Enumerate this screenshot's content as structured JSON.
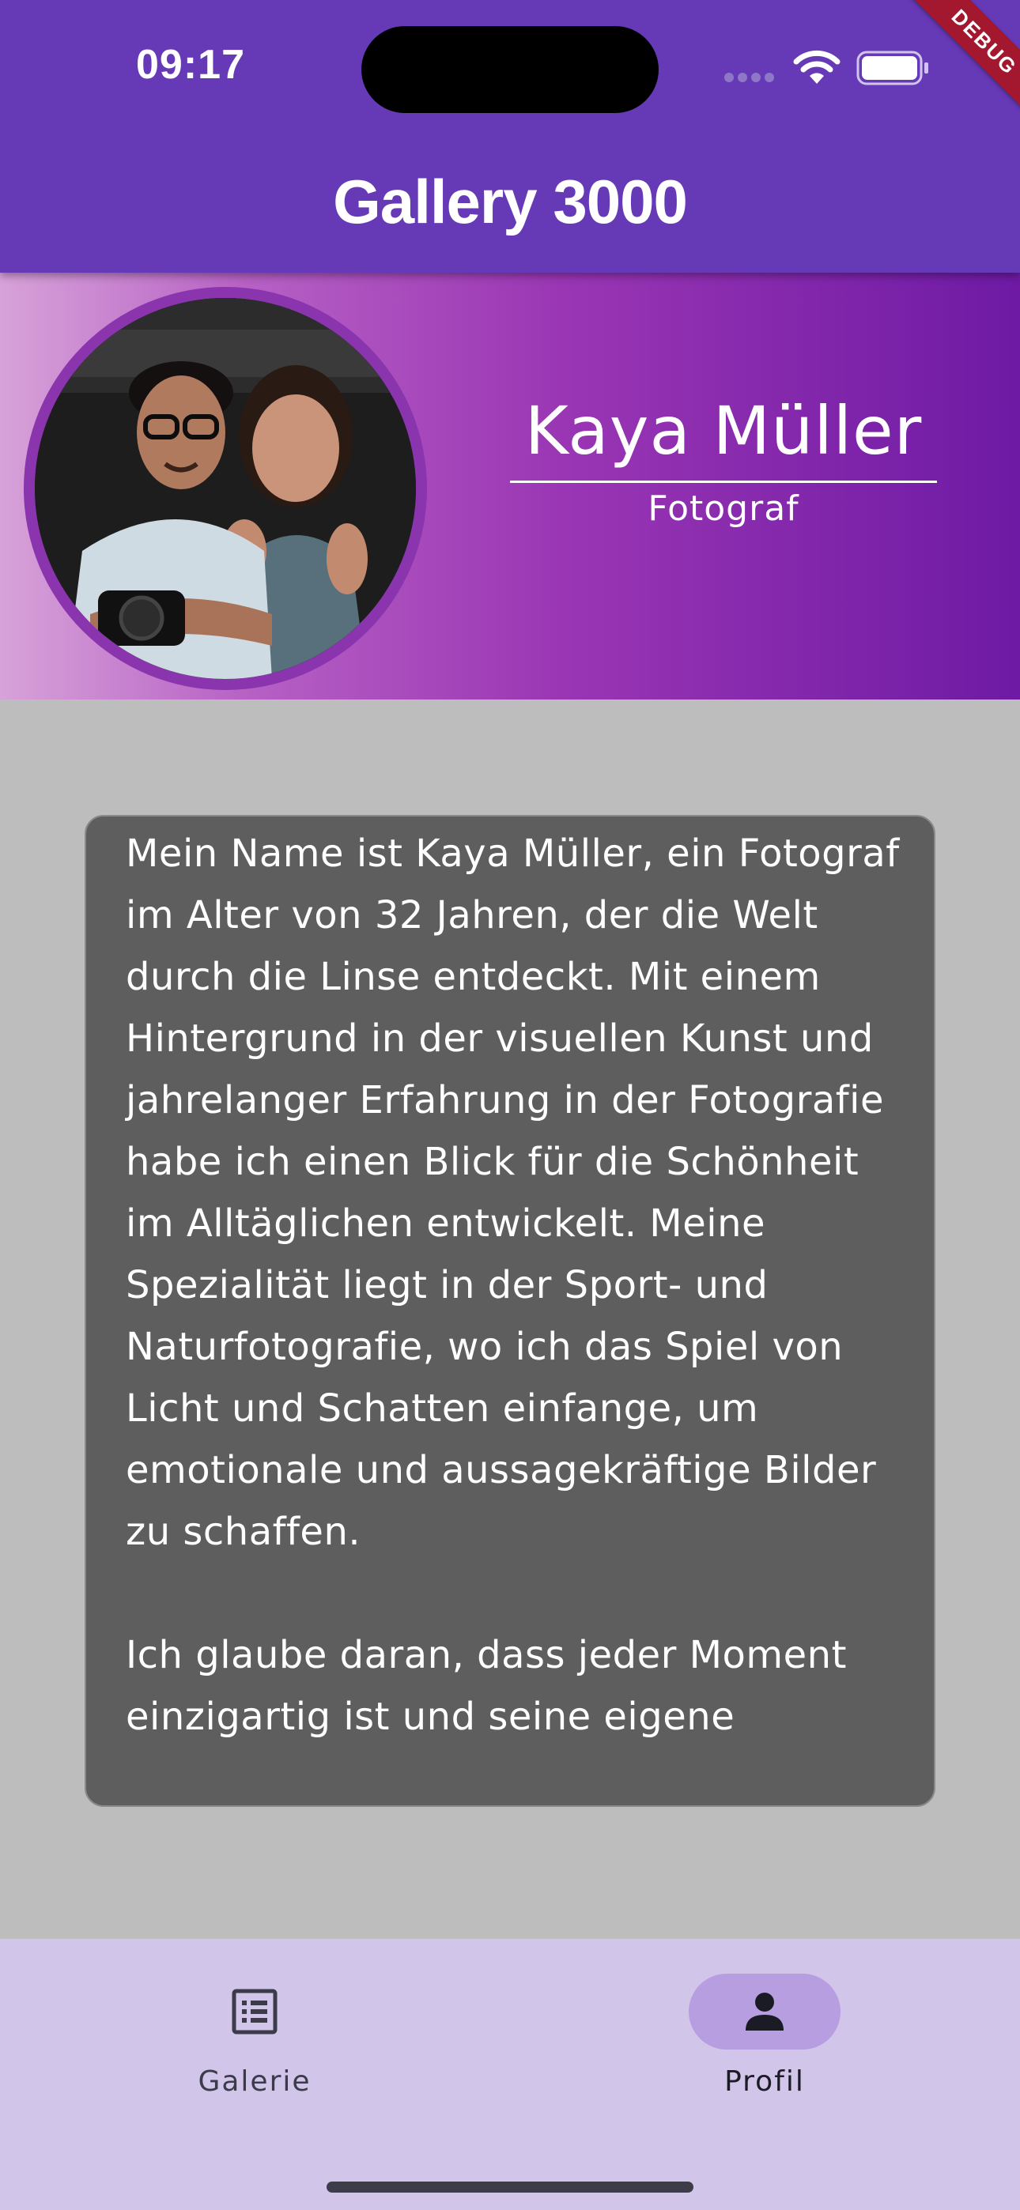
{
  "status_bar": {
    "time": "09:17"
  },
  "app_bar": {
    "title": "Gallery 3000",
    "debug_banner": "DEBUG",
    "background_color": "#663ab7"
  },
  "profile": {
    "name": "Kaya Müller",
    "role": "Fotograf",
    "avatar_icon": "profile-photo"
  },
  "bio": {
    "text": "Mein Name ist Kaya Müller, ein Fotograf im Alter von 32 Jahren, der die Welt durch die Linse entdeckt. Mit einem Hintergrund in der visuellen Kunst und jahrelanger Erfahrung in der Fotografie habe ich einen Blick für die Schönheit im Alltäglichen entwickelt. Meine Spezialität liegt in der Sport- und Naturfotografie, wo ich das Spiel von Licht und Schatten einfange, um emotionale und aussagekräftige Bilder zu schaffen.\n\nIch glaube daran, dass jeder Moment einzigartig ist und seine eigene"
  },
  "bottom_nav": {
    "items": [
      {
        "label": "Galerie",
        "icon": "list-icon",
        "selected": false
      },
      {
        "label": "Profil",
        "icon": "person-icon",
        "selected": true
      }
    ]
  }
}
